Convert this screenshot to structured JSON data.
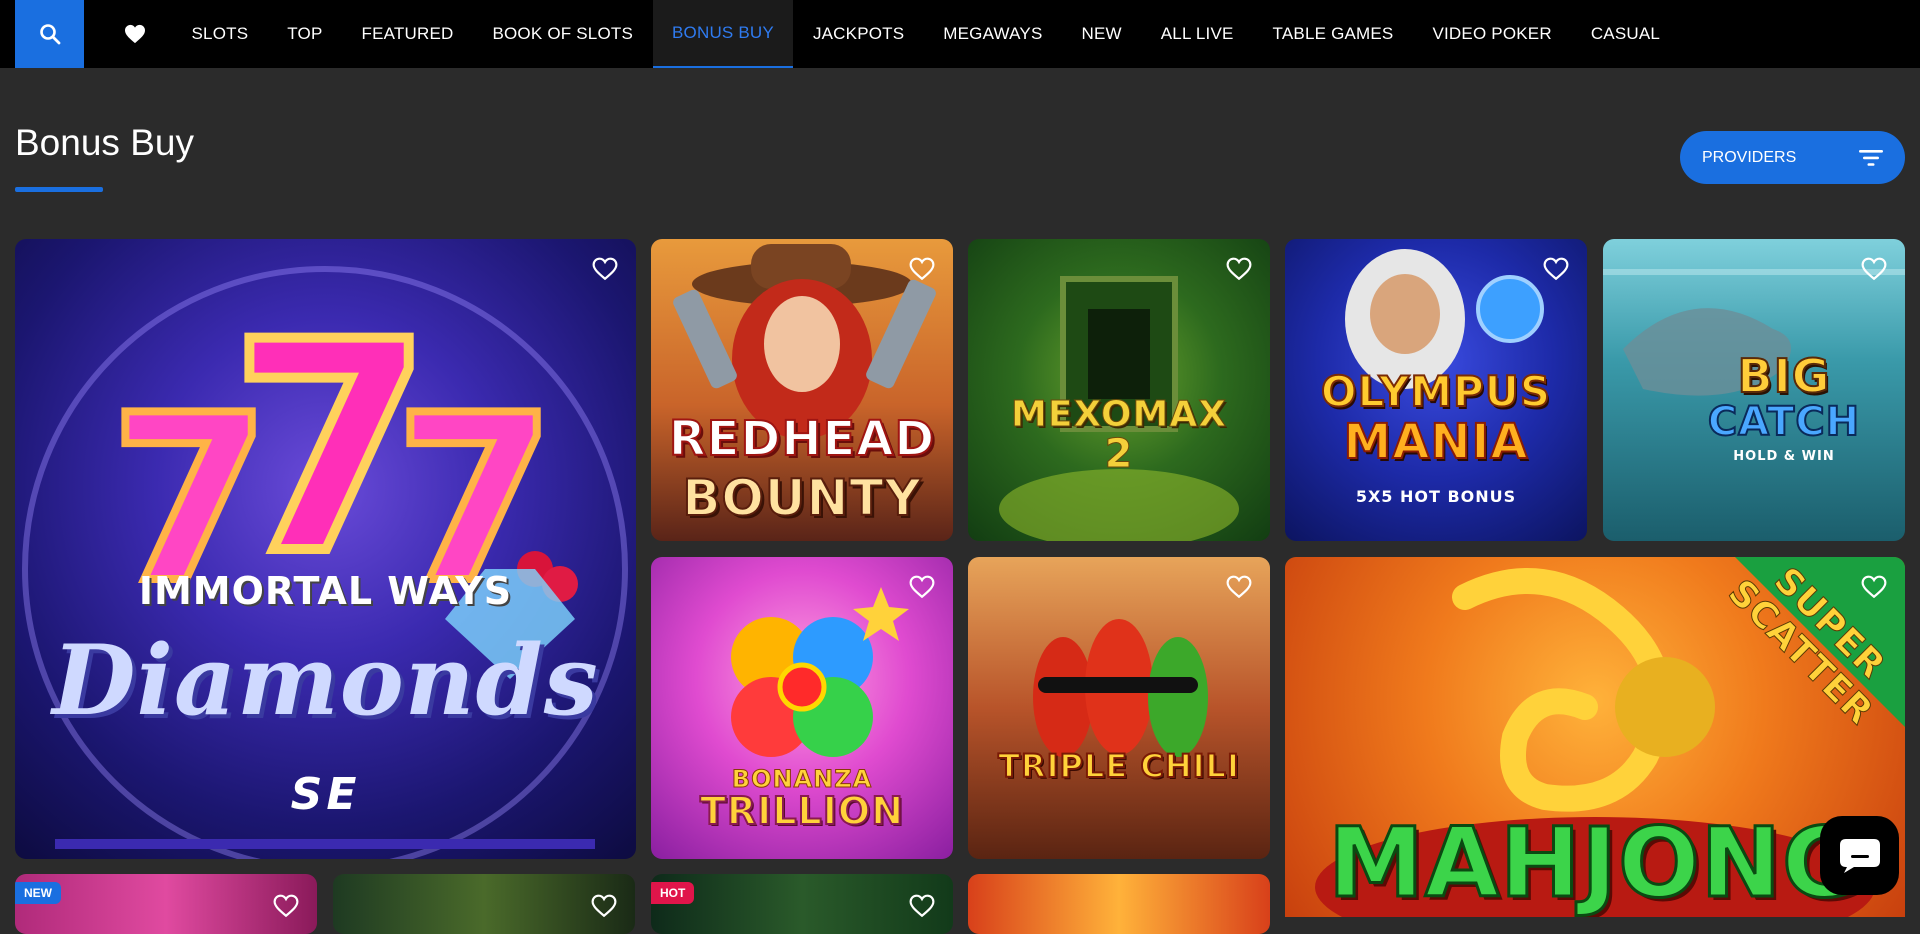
{
  "nav": {
    "search_icon": "search-icon",
    "favorites_icon": "heart-icon",
    "items": [
      {
        "label": "SLOTS",
        "active": false
      },
      {
        "label": "TOP",
        "active": false
      },
      {
        "label": "FEATURED",
        "active": false
      },
      {
        "label": "BOOK OF SLOTS",
        "active": false
      },
      {
        "label": "BONUS BUY",
        "active": true
      },
      {
        "label": "JACKPOTS",
        "active": false
      },
      {
        "label": "MEGAWAYS",
        "active": false
      },
      {
        "label": "NEW",
        "active": false
      },
      {
        "label": "ALL LIVE",
        "active": false
      },
      {
        "label": "TABLE GAMES",
        "active": false
      },
      {
        "label": "VIDEO POKER",
        "active": false
      },
      {
        "label": "CASUAL",
        "active": false
      }
    ]
  },
  "page": {
    "title": "Bonus Buy"
  },
  "providers": {
    "label": "PROVIDERS",
    "icon": "filter-icon"
  },
  "games": [
    {
      "title_line1": "IMMORTAL WAYS",
      "title_line2": "Diamonds",
      "title_line3": "SE"
    },
    {
      "title_line1": "REDHEAD",
      "title_line2": "BOUNTY"
    },
    {
      "title_line1": "MEXOMAX",
      "title_line2": "2"
    },
    {
      "title_line1": "OLYMPUS",
      "title_line2": "MANIA",
      "title_line3": "5X5 HOT BONUS"
    },
    {
      "title_line1": "BIG",
      "title_line2": "CATCH",
      "title_line3": "HOLD & WIN"
    },
    {
      "title_line1": "BONANZA",
      "title_line2": "TRILLION"
    },
    {
      "title_line1": "TRIPLE CHILI"
    },
    {
      "title_line1": "MAHJONG",
      "title_line2": "SUPER SCATTER"
    }
  ],
  "bottom_badges": {
    "new": "NEW",
    "hot": "HOT"
  },
  "colors": {
    "accent": "#1a6fe0",
    "background": "#2b2b2b",
    "nav_bg": "#000000",
    "badge_new": "#1a6fe0",
    "badge_hot": "#e0154a"
  },
  "chat": {
    "icon": "chat-bubble-icon"
  }
}
